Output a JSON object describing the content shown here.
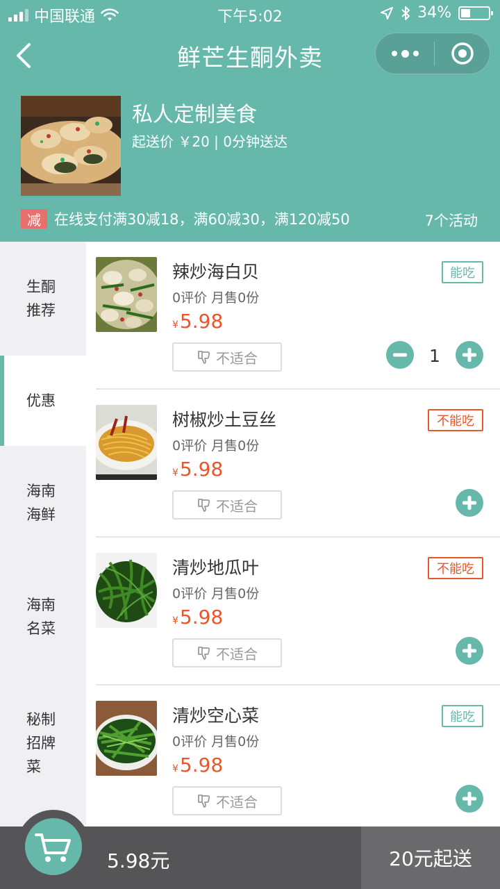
{
  "status_bar": {
    "carrier": "中国联通",
    "time": "下午5:02",
    "battery": "34%",
    "battery_level": 0.34
  },
  "nav": {
    "title": "鲜芒生酮外卖"
  },
  "shop": {
    "name": "私人定制美食",
    "info": "起送价 ￥20 | 0分钟送达",
    "promo_badge": "减",
    "promo_text": "在线支付满30减18，满60减30，满120减50",
    "promo_count": "7个活动"
  },
  "sidebar": {
    "items": [
      {
        "label": "生酮\n推荐",
        "active": false
      },
      {
        "label": "优惠",
        "active": true
      },
      {
        "label": "海南\n海鲜",
        "active": false
      },
      {
        "label": "海南\n名菜",
        "active": false
      },
      {
        "label": "秘制\n招牌\n菜",
        "active": false
      }
    ]
  },
  "dishes": [
    {
      "name": "辣炒海白贝",
      "meta": "0评价 月售0份",
      "currency": "¥",
      "price": "5.98",
      "tag": "能吃",
      "unsuitable": "不适合",
      "quantity": "1"
    },
    {
      "name": "树椒炒土豆丝",
      "meta": "0评价 月售0份",
      "currency": "¥",
      "price": "5.98",
      "tag": "不能吃",
      "unsuitable": "不适合"
    },
    {
      "name": "清炒地瓜叶",
      "meta": "0评价 月售0份",
      "currency": "¥",
      "price": "5.98",
      "tag": "不能吃",
      "unsuitable": "不适合"
    },
    {
      "name": "清炒空心菜",
      "meta": "0评价 月售0份",
      "currency": "¥",
      "price": "5.98",
      "tag": "能吃",
      "unsuitable": "不适合"
    }
  ],
  "cart": {
    "total": "5.98元",
    "checkout_label": "20元起送"
  },
  "colors": {
    "primary": "#66b8ab",
    "price": "#e8562a",
    "promo": "#e96f6c",
    "bottom_bar": "#555557"
  }
}
